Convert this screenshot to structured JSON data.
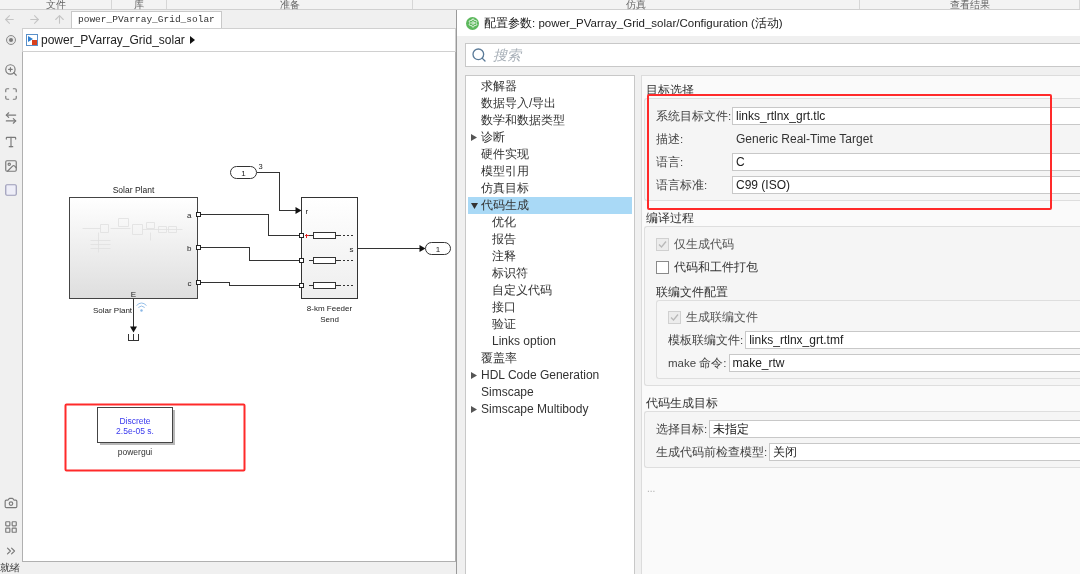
{
  "ribbon_tabs": [
    "文件",
    "库",
    "准备",
    "仿真",
    "查看结果"
  ],
  "model_window": {
    "tab": "power_PVarray_Grid_solar",
    "breadcrumb": "power_PVarray_Grid_solar",
    "diagram": {
      "solar_plant": {
        "title": "Solar Plant",
        "ports": [
          "a",
          "b",
          "c"
        ],
        "bottom_port": "E",
        "label": "Solar Plant"
      },
      "inport": {
        "number": "1",
        "signal_label": "3"
      },
      "feeder": {
        "input_port": "r",
        "output_port": "s",
        "label": [
          "8-km Feeder",
          "Send"
        ]
      },
      "outport": {
        "number": "1"
      },
      "powergui": {
        "lines": [
          "Discrete",
          "2.5e-05 s."
        ],
        "label": "powergui"
      }
    },
    "status": "就绪"
  },
  "config_dialog": {
    "title": "配置参数: power_PVarray_Grid_solar/Configuration (活动)",
    "search": {
      "placeholder": "搜索"
    },
    "tree": [
      {
        "label": "求解器",
        "kind": "leaf",
        "selected": false
      },
      {
        "label": "数据导入/导出",
        "kind": "leaf",
        "selected": false
      },
      {
        "label": "数学和数据类型",
        "kind": "leaf",
        "selected": false
      },
      {
        "label": "诊断",
        "kind": "branch",
        "expanded": false,
        "selected": false
      },
      {
        "label": "硬件实现",
        "kind": "leaf",
        "selected": false
      },
      {
        "label": "模型引用",
        "kind": "leaf",
        "selected": false
      },
      {
        "label": "仿真目标",
        "kind": "leaf",
        "selected": false
      },
      {
        "label": "代码生成",
        "kind": "branch",
        "expanded": true,
        "selected": true,
        "children": [
          {
            "label": "优化",
            "kind": "leaf",
            "selected": false
          },
          {
            "label": "报告",
            "kind": "leaf",
            "selected": false
          },
          {
            "label": "注释",
            "kind": "leaf",
            "selected": false
          },
          {
            "label": "标识符",
            "kind": "leaf",
            "selected": false
          },
          {
            "label": "自定义代码",
            "kind": "leaf",
            "selected": false
          },
          {
            "label": "接口",
            "kind": "leaf",
            "selected": false
          },
          {
            "label": "验证",
            "kind": "leaf",
            "selected": false
          },
          {
            "label": "Links option",
            "kind": "leaf",
            "selected": false
          }
        ]
      },
      {
        "label": "覆盖率",
        "kind": "leaf",
        "selected": false
      },
      {
        "label": "HDL Code Generation",
        "kind": "branch",
        "expanded": false,
        "selected": false
      },
      {
        "label": "Simscape",
        "kind": "leaf",
        "selected": false
      },
      {
        "label": "Simscape Multibody",
        "kind": "branch",
        "expanded": false,
        "selected": false
      }
    ],
    "groups": [
      {
        "title": "目标选择",
        "rows": [
          {
            "kind": "field",
            "label": "系统目标文件:",
            "value": "links_rtlnx_grt.tlc"
          },
          {
            "kind": "text",
            "label": "描述:",
            "value": "Generic Real-Time Target"
          },
          {
            "kind": "field",
            "label": "语言:",
            "value": "C"
          },
          {
            "kind": "field",
            "label": "语言标准:",
            "value": "C99 (ISO)"
          }
        ]
      },
      {
        "title": "编译过程",
        "rows": [
          {
            "kind": "checkbox",
            "label": "仅生成代码",
            "checked": true,
            "disabled": true
          },
          {
            "kind": "checkbox",
            "label": "代码和工件打包",
            "checked": false,
            "disabled": false
          },
          {
            "kind": "group",
            "title": "联编文件配置",
            "rows": [
              {
                "kind": "checkbox",
                "label": "生成联编文件",
                "checked": true,
                "disabled": true
              },
              {
                "kind": "field",
                "label": "模板联编文件:",
                "value": "links_rtlnx_grt.tmf"
              },
              {
                "kind": "field",
                "label": "make 命令:",
                "value": "make_rtw"
              }
            ]
          }
        ]
      },
      {
        "title": "代码生成目标",
        "rows": [
          {
            "kind": "field",
            "label": "选择目标:",
            "value": "未指定"
          },
          {
            "kind": "field",
            "label": "生成代码前检查模型:",
            "value": "关闭"
          }
        ]
      }
    ],
    "more": "..."
  }
}
